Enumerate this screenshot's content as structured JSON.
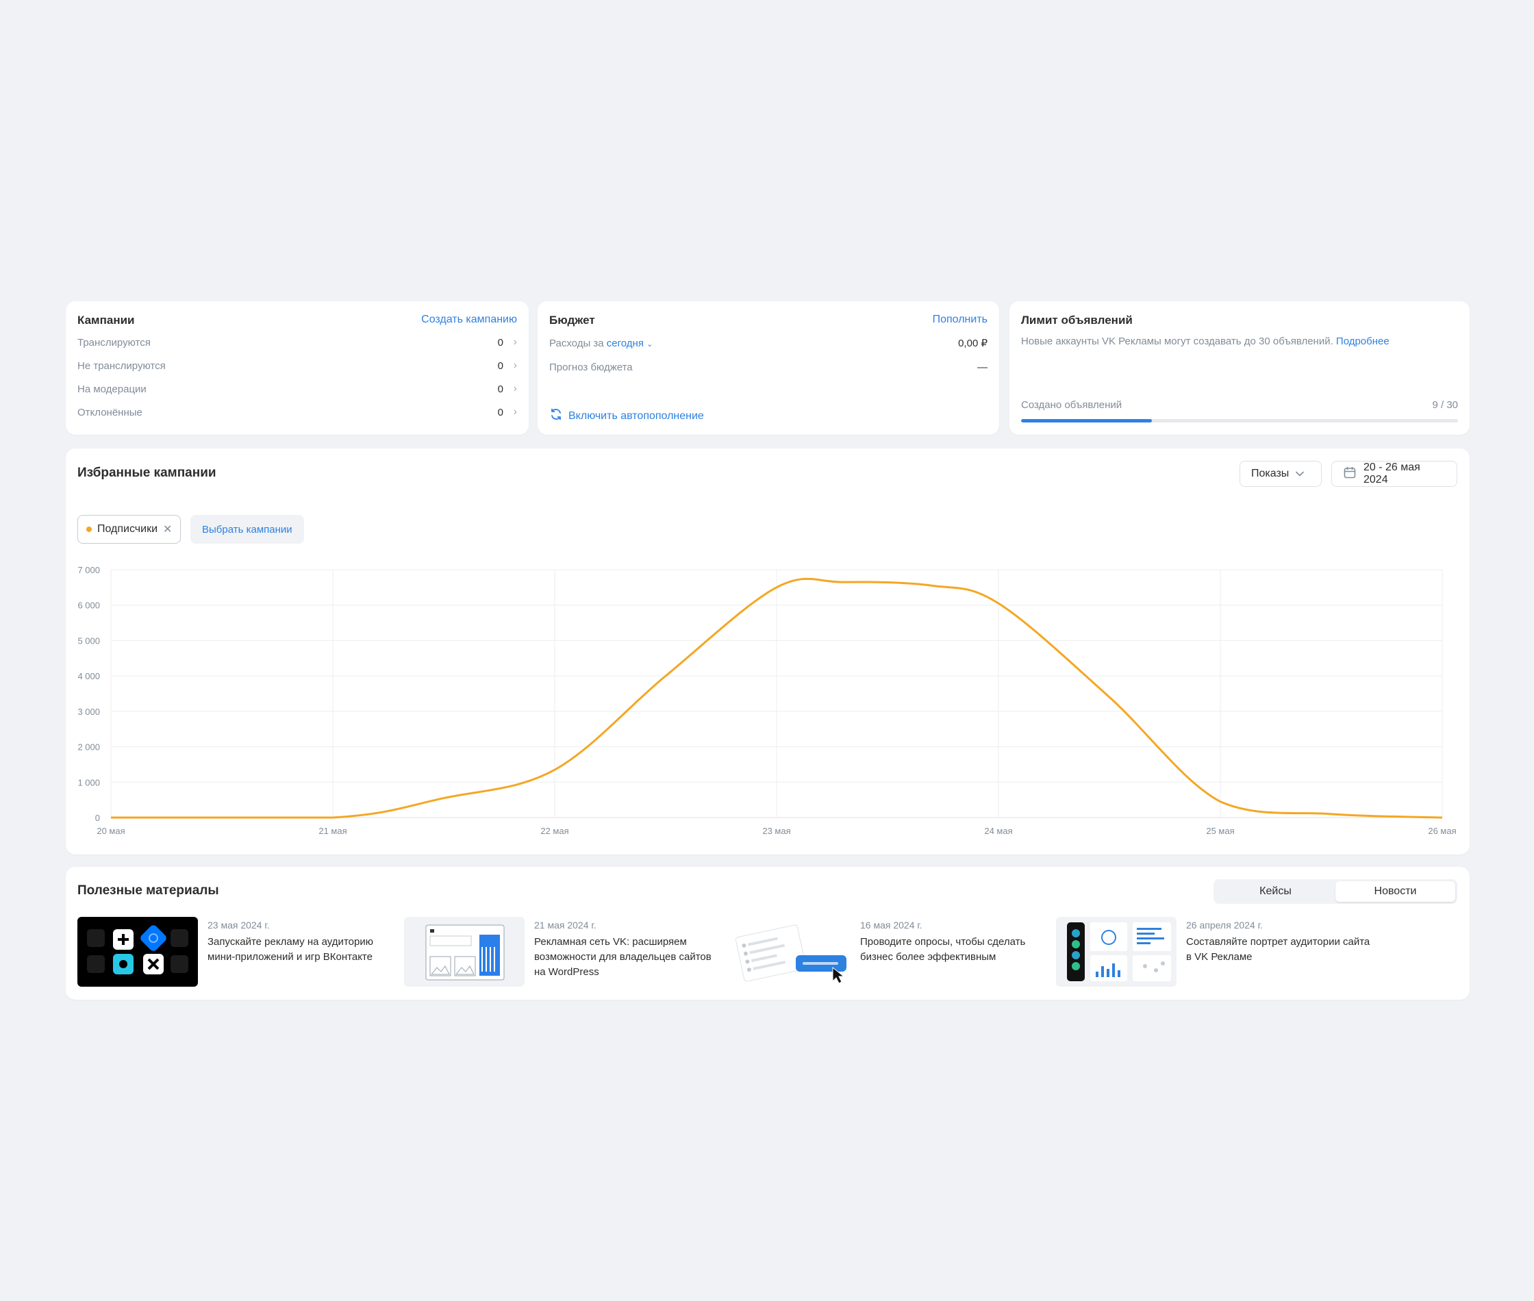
{
  "campaigns": {
    "title": "Кампании",
    "create_link": "Создать кампанию",
    "rows": [
      {
        "label": "Транслируются",
        "value": "0"
      },
      {
        "label": "Не транслируются",
        "value": "0"
      },
      {
        "label": "На модерации",
        "value": "0"
      },
      {
        "label": "Отклонённые",
        "value": "0"
      }
    ]
  },
  "budget": {
    "title": "Бюджет",
    "topup_link": "Пополнить",
    "spend_label": "Расходы за",
    "spend_period": "сегодня",
    "spend_value": "0,00 ₽",
    "forecast_label": "Прогноз бюджета",
    "forecast_value": "—",
    "autotopup_link": "Включить автопополнение"
  },
  "limit": {
    "title": "Лимит объявлений",
    "description": "Новые аккаунты VK Рекламы могут создавать до 30 объявлений.",
    "more_link": "Подробнее",
    "created_label": "Создано объявлений",
    "created_value": "9 / 30",
    "progress_fraction": 0.3
  },
  "featured": {
    "title": "Избранные кампании",
    "metric_select": "Показы",
    "date_range": "20 - 26 мая 2024",
    "chip_label": "Подписчики",
    "select_campaigns": "Выбрать кампании"
  },
  "chart_data": {
    "type": "line",
    "x": [
      "20 мая",
      "21 мая",
      "22 мая",
      "23 мая",
      "24 мая",
      "25 мая",
      "26 мая"
    ],
    "y_ticks": [
      "0",
      "1 000",
      "2 000",
      "3 000",
      "4 000",
      "5 000",
      "6 000",
      "7 000"
    ],
    "ylim": [
      0,
      7000
    ],
    "grid": true,
    "series": [
      {
        "name": "Подписчики",
        "color": "#f5a623",
        "points": [
          [
            0,
            0
          ],
          [
            1,
            0
          ],
          [
            1.5,
            550
          ],
          [
            2,
            1350
          ],
          [
            2.5,
            4000
          ],
          [
            3,
            6500
          ],
          [
            3.3,
            6650
          ],
          [
            3.7,
            6550
          ],
          [
            4,
            6050
          ],
          [
            4.5,
            3400
          ],
          [
            5,
            450
          ],
          [
            5.5,
            100
          ],
          [
            6,
            0
          ]
        ]
      }
    ]
  },
  "materials": {
    "title": "Полезные материалы",
    "tabs": [
      {
        "label": "Кейсы",
        "active": false
      },
      {
        "label": "Новости",
        "active": true
      }
    ],
    "articles": [
      {
        "date": "23 мая 2024 г.",
        "title": "Запускайте рекламу на аудиторию мини-приложений и игр ВКонтакте"
      },
      {
        "date": "21 мая 2024 г.",
        "title": "Рекламная сеть VK: расширяем возможности для владельцев сайтов на WordPress"
      },
      {
        "date": "16 мая 2024 г.",
        "title": "Проводите опросы, чтобы сделать бизнес более эффективным"
      },
      {
        "date": "26 апреля 2024 г.",
        "title": "Составляйте портрет аудитории сайта в VK Рекламе"
      }
    ]
  }
}
